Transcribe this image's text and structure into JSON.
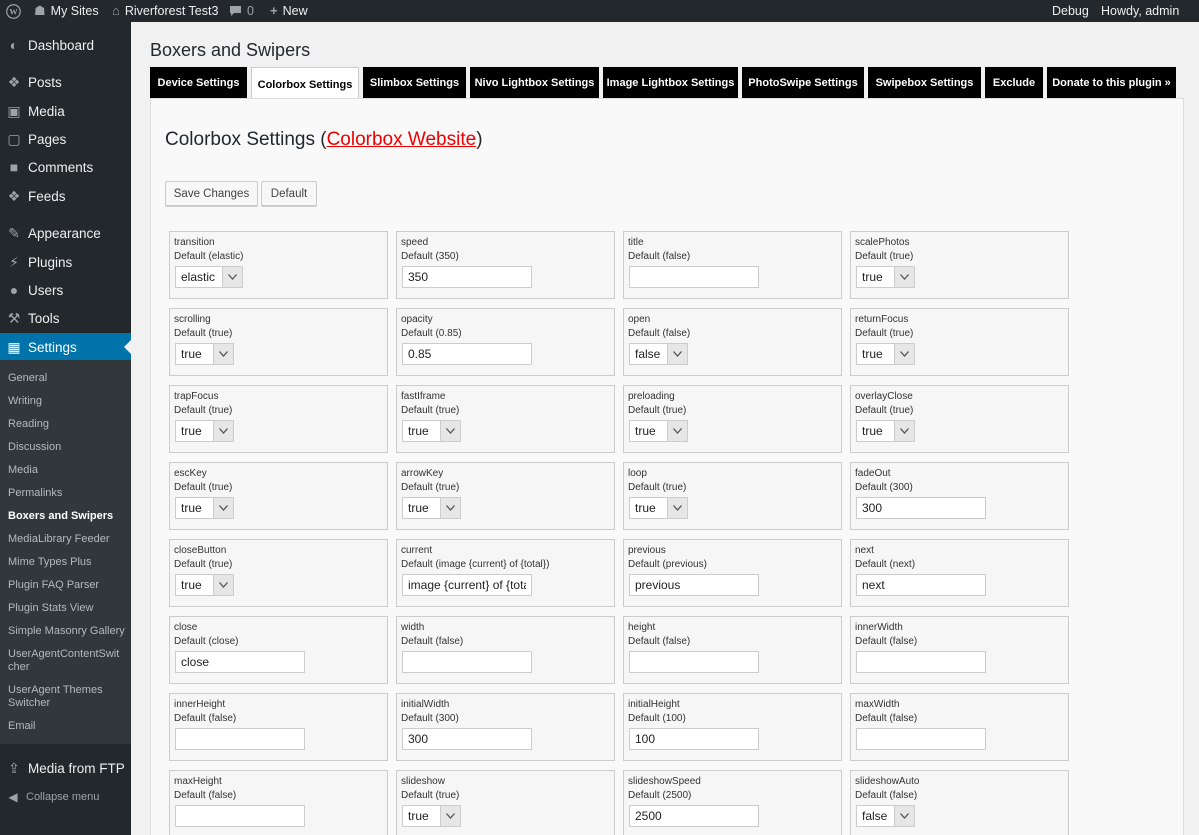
{
  "adminbar": {
    "my_sites": "My Sites",
    "site_name": "Riverforest Test3",
    "comments_count": "0",
    "new_label": "New",
    "debug": "Debug",
    "howdy": "Howdy, admin"
  },
  "sidebar": {
    "menu": [
      "Dashboard",
      "Posts",
      "Media",
      "Pages",
      "Comments",
      "Feeds",
      "Appearance",
      "Plugins",
      "Users",
      "Tools",
      "Settings"
    ],
    "submenu": [
      "General",
      "Writing",
      "Reading",
      "Discussion",
      "Media",
      "Permalinks",
      "Boxers and Swipers",
      "MediaLibrary Feeder",
      "Mime Types Plus",
      "Plugin FAQ Parser",
      "Plugin Stats View",
      "Simple Masonry Gallery",
      "UserAgentContentSwitcher",
      "UserAgent Themes Switcher",
      "Email"
    ],
    "media_from_ftp": "Media from FTP",
    "collapse": "Collapse menu"
  },
  "page": {
    "heading": "Boxers and Swipers",
    "tabs": [
      "Device Settings",
      "Colorbox Settings",
      "Slimbox Settings",
      "Nivo Lightbox Settings",
      "Image Lightbox Settings",
      "PhotoSwipe Settings",
      "Swipebox Settings",
      "Exclude",
      "Donate to this plugin »"
    ],
    "section_title_prefix": "Colorbox Settings (",
    "section_title_link": "Colorbox Website",
    "section_title_suffix": ")",
    "save_button": "Save Changes",
    "default_button": "Default"
  },
  "settings": [
    {
      "name": "transition",
      "default": "Default (elastic)",
      "type": "select",
      "value": "elastic"
    },
    {
      "name": "speed",
      "default": "Default (350)",
      "type": "text",
      "value": "350"
    },
    {
      "name": "title",
      "default": "Default (false)",
      "type": "text",
      "value": ""
    },
    {
      "name": "scalePhotos",
      "default": "Default (true)",
      "type": "select",
      "value": "true"
    },
    {
      "name": "scrolling",
      "default": "Default (true)",
      "type": "select",
      "value": "true"
    },
    {
      "name": "opacity",
      "default": "Default (0.85)",
      "type": "text",
      "value": "0.85"
    },
    {
      "name": "open",
      "default": "Default (false)",
      "type": "select",
      "value": "false"
    },
    {
      "name": "returnFocus",
      "default": "Default (true)",
      "type": "select",
      "value": "true"
    },
    {
      "name": "trapFocus",
      "default": "Default (true)",
      "type": "select",
      "value": "true"
    },
    {
      "name": "fastIframe",
      "default": "Default (true)",
      "type": "select",
      "value": "true"
    },
    {
      "name": "preloading",
      "default": "Default (true)",
      "type": "select",
      "value": "true"
    },
    {
      "name": "overlayClose",
      "default": "Default (true)",
      "type": "select",
      "value": "true"
    },
    {
      "name": "escKey",
      "default": "Default (true)",
      "type": "select",
      "value": "true"
    },
    {
      "name": "arrowKey",
      "default": "Default (true)",
      "type": "select",
      "value": "true"
    },
    {
      "name": "loop",
      "default": "Default (true)",
      "type": "select",
      "value": "true"
    },
    {
      "name": "fadeOut",
      "default": "Default (300)",
      "type": "text",
      "value": "300"
    },
    {
      "name": "closeButton",
      "default": "Default (true)",
      "type": "select",
      "value": "true"
    },
    {
      "name": "current",
      "default": "Default (image {current} of {total})",
      "type": "text",
      "value": "image {current} of {total}"
    },
    {
      "name": "previous",
      "default": "Default (previous)",
      "type": "text",
      "value": "previous"
    },
    {
      "name": "next",
      "default": "Default (next)",
      "type": "text",
      "value": "next"
    },
    {
      "name": "close",
      "default": "Default (close)",
      "type": "text",
      "value": "close"
    },
    {
      "name": "width",
      "default": "Default (false)",
      "type": "text",
      "value": ""
    },
    {
      "name": "height",
      "default": "Default (false)",
      "type": "text",
      "value": ""
    },
    {
      "name": "innerWidth",
      "default": "Default (false)",
      "type": "text",
      "value": ""
    },
    {
      "name": "innerHeight",
      "default": "Default (false)",
      "type": "text",
      "value": ""
    },
    {
      "name": "initialWidth",
      "default": "Default (300)",
      "type": "text",
      "value": "300"
    },
    {
      "name": "initialHeight",
      "default": "Default (100)",
      "type": "text",
      "value": "100"
    },
    {
      "name": "maxWidth",
      "default": "Default (false)",
      "type": "text",
      "value": ""
    },
    {
      "name": "maxHeight",
      "default": "Default (false)",
      "type": "text",
      "value": ""
    },
    {
      "name": "slideshow",
      "default": "Default (true)",
      "type": "select",
      "value": "true"
    },
    {
      "name": "slideshowSpeed",
      "default": "Default (2500)",
      "type": "text",
      "value": "2500"
    },
    {
      "name": "slideshowAuto",
      "default": "Default (false)",
      "type": "select",
      "value": "false"
    }
  ],
  "colors": {
    "accent": "#0073aa",
    "link": "#ee0000",
    "admin_bg": "#23282d",
    "submenu_bg": "#32373c"
  }
}
